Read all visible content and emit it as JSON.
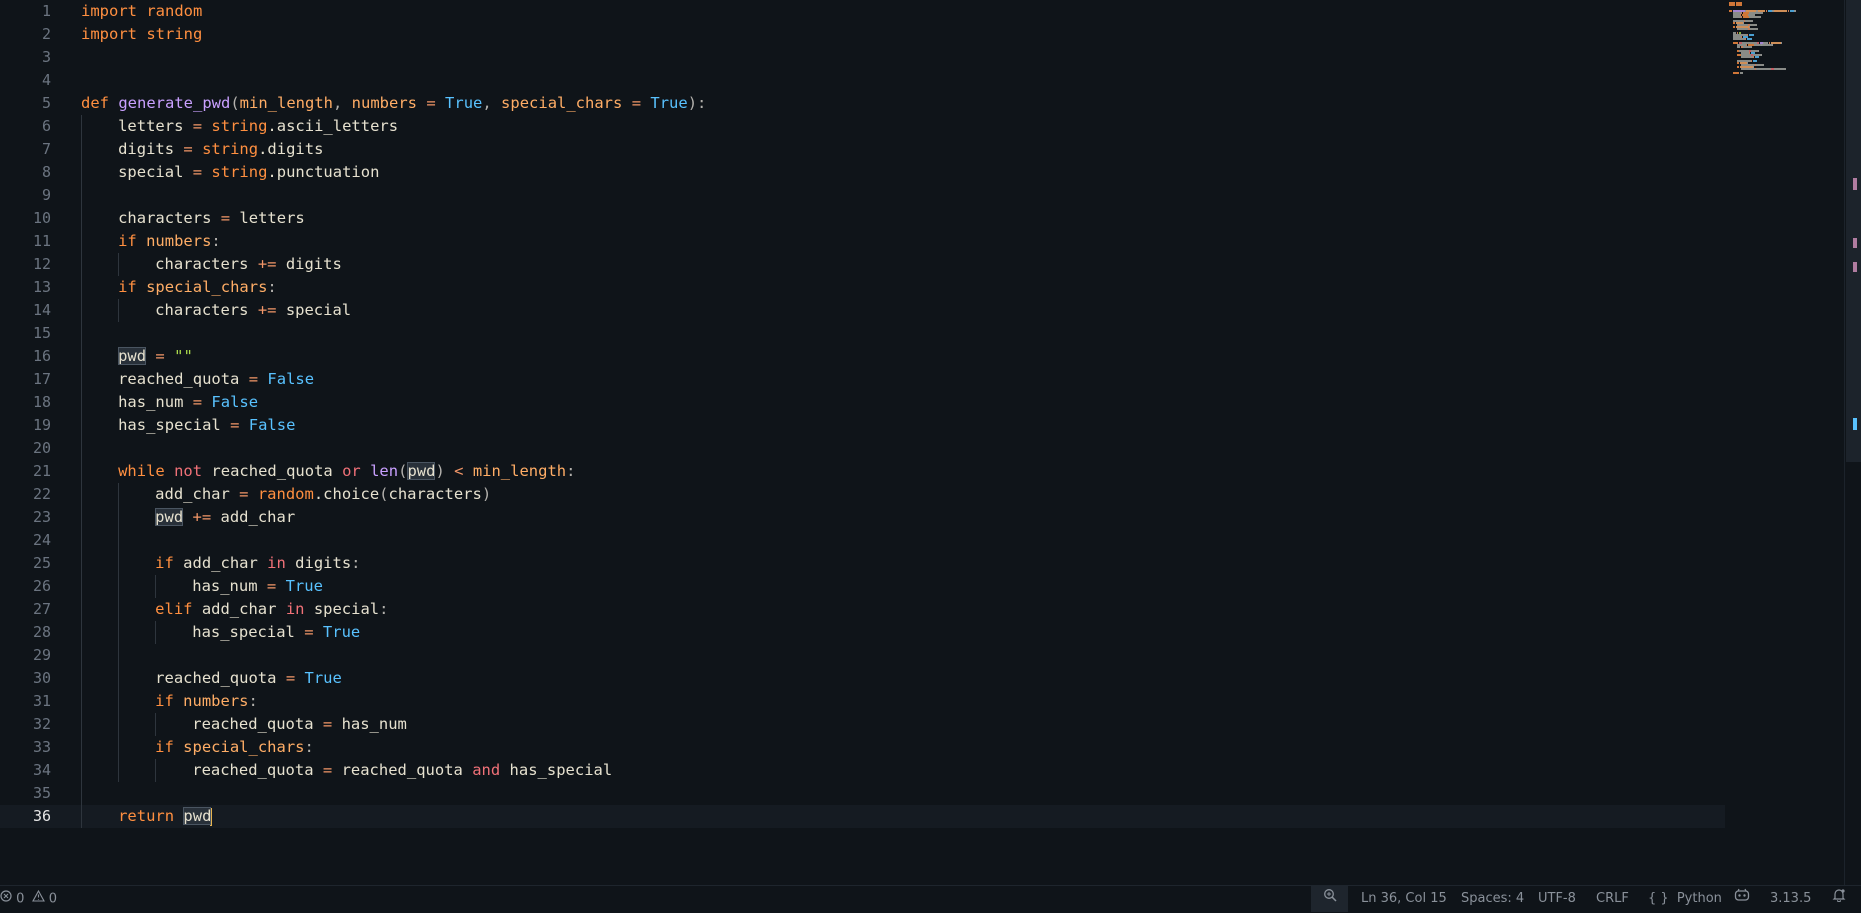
{
  "editor": {
    "current_line": 36,
    "lines": [
      {
        "n": "1",
        "indent": 0,
        "tokens": [
          [
            "t-kw",
            "import"
          ],
          [
            "t-var",
            " "
          ],
          [
            "t-mod",
            "random"
          ]
        ]
      },
      {
        "n": "2",
        "indent": 0,
        "tokens": [
          [
            "t-kw",
            "import"
          ],
          [
            "t-var",
            " "
          ],
          [
            "t-mod",
            "string"
          ]
        ]
      },
      {
        "n": "3",
        "indent": 0,
        "tokens": []
      },
      {
        "n": "4",
        "indent": 0,
        "tokens": []
      },
      {
        "n": "5",
        "indent": 0,
        "tokens": [
          [
            "t-kw",
            "def"
          ],
          [
            "t-var",
            " "
          ],
          [
            "t-fn",
            "generate_pwd"
          ],
          [
            "t-punc",
            "("
          ],
          [
            "t-param",
            "min_length"
          ],
          [
            "t-punc",
            ", "
          ],
          [
            "t-param",
            "numbers"
          ],
          [
            "t-var",
            " "
          ],
          [
            "t-op",
            "="
          ],
          [
            "t-var",
            " "
          ],
          [
            "t-const",
            "True"
          ],
          [
            "t-punc",
            ", "
          ],
          [
            "t-param",
            "special_chars"
          ],
          [
            "t-var",
            " "
          ],
          [
            "t-op",
            "="
          ],
          [
            "t-var",
            " "
          ],
          [
            "t-const",
            "True"
          ],
          [
            "t-punc",
            "):"
          ]
        ]
      },
      {
        "n": "6",
        "indent": 1,
        "tokens": [
          [
            "t-var",
            "letters "
          ],
          [
            "t-op",
            "="
          ],
          [
            "t-var",
            " "
          ],
          [
            "t-mod",
            "string"
          ],
          [
            "t-var",
            ".ascii_letters"
          ]
        ]
      },
      {
        "n": "7",
        "indent": 1,
        "tokens": [
          [
            "t-var",
            "digits "
          ],
          [
            "t-op",
            "="
          ],
          [
            "t-var",
            " "
          ],
          [
            "t-mod",
            "string"
          ],
          [
            "t-var",
            ".digits"
          ]
        ]
      },
      {
        "n": "8",
        "indent": 1,
        "tokens": [
          [
            "t-var",
            "special "
          ],
          [
            "t-op",
            "="
          ],
          [
            "t-var",
            " "
          ],
          [
            "t-mod",
            "string"
          ],
          [
            "t-var",
            ".punctuation"
          ]
        ]
      },
      {
        "n": "9",
        "indent": 1,
        "tokens": []
      },
      {
        "n": "10",
        "indent": 1,
        "tokens": [
          [
            "t-var",
            "characters "
          ],
          [
            "t-op",
            "="
          ],
          [
            "t-var",
            " letters"
          ]
        ]
      },
      {
        "n": "11",
        "indent": 1,
        "tokens": [
          [
            "t-kw",
            "if"
          ],
          [
            "t-var",
            " "
          ],
          [
            "t-param",
            "numbers"
          ],
          [
            "t-punc",
            ":"
          ]
        ]
      },
      {
        "n": "12",
        "indent": 2,
        "tokens": [
          [
            "t-var",
            "characters "
          ],
          [
            "t-op",
            "+="
          ],
          [
            "t-var",
            " digits"
          ]
        ]
      },
      {
        "n": "13",
        "indent": 1,
        "tokens": [
          [
            "t-kw",
            "if"
          ],
          [
            "t-var",
            " "
          ],
          [
            "t-param",
            "special_chars"
          ],
          [
            "t-punc",
            ":"
          ]
        ]
      },
      {
        "n": "14",
        "indent": 2,
        "tokens": [
          [
            "t-var",
            "characters "
          ],
          [
            "t-op",
            "+="
          ],
          [
            "t-var",
            " special"
          ]
        ]
      },
      {
        "n": "15",
        "indent": 1,
        "tokens": []
      },
      {
        "n": "16",
        "indent": 1,
        "tokens": [
          [
            "t-var hl",
            "pwd"
          ],
          [
            "t-var",
            " "
          ],
          [
            "t-op",
            "="
          ],
          [
            "t-var",
            " "
          ],
          [
            "t-str",
            "\"\""
          ]
        ]
      },
      {
        "n": "17",
        "indent": 1,
        "tokens": [
          [
            "t-var",
            "reached_quota "
          ],
          [
            "t-op",
            "="
          ],
          [
            "t-var",
            " "
          ],
          [
            "t-const",
            "False"
          ]
        ]
      },
      {
        "n": "18",
        "indent": 1,
        "tokens": [
          [
            "t-var",
            "has_num "
          ],
          [
            "t-op",
            "="
          ],
          [
            "t-var",
            " "
          ],
          [
            "t-const",
            "False"
          ]
        ]
      },
      {
        "n": "19",
        "indent": 1,
        "tokens": [
          [
            "t-var",
            "has_special "
          ],
          [
            "t-op",
            "="
          ],
          [
            "t-var",
            " "
          ],
          [
            "t-const",
            "False"
          ]
        ]
      },
      {
        "n": "20",
        "indent": 1,
        "tokens": []
      },
      {
        "n": "21",
        "indent": 1,
        "tokens": [
          [
            "t-kw",
            "while"
          ],
          [
            "t-var",
            " "
          ],
          [
            "t-kw2",
            "not"
          ],
          [
            "t-var",
            " reached_quota "
          ],
          [
            "t-kw2",
            "or"
          ],
          [
            "t-var",
            " "
          ],
          [
            "t-fn",
            "len"
          ],
          [
            "t-punc",
            "("
          ],
          [
            "t-var hl",
            "pwd"
          ],
          [
            "t-punc",
            ")"
          ],
          [
            "t-var",
            " "
          ],
          [
            "t-op",
            "<"
          ],
          [
            "t-var",
            " "
          ],
          [
            "t-param",
            "min_length"
          ],
          [
            "t-punc",
            ":"
          ]
        ]
      },
      {
        "n": "22",
        "indent": 2,
        "tokens": [
          [
            "t-var",
            "add_char "
          ],
          [
            "t-op",
            "="
          ],
          [
            "t-var",
            " "
          ],
          [
            "t-mod",
            "random"
          ],
          [
            "t-var",
            ".choice"
          ],
          [
            "t-punc",
            "("
          ],
          [
            "t-var",
            "characters"
          ],
          [
            "t-punc",
            ")"
          ]
        ]
      },
      {
        "n": "23",
        "indent": 2,
        "tokens": [
          [
            "t-var hl",
            "pwd"
          ],
          [
            "t-var",
            " "
          ],
          [
            "t-op",
            "+="
          ],
          [
            "t-var",
            " add_char"
          ]
        ]
      },
      {
        "n": "24",
        "indent": 2,
        "tokens": []
      },
      {
        "n": "25",
        "indent": 2,
        "tokens": [
          [
            "t-kw",
            "if"
          ],
          [
            "t-var",
            " add_char "
          ],
          [
            "t-kw2",
            "in"
          ],
          [
            "t-var",
            " digits"
          ],
          [
            "t-punc",
            ":"
          ]
        ]
      },
      {
        "n": "26",
        "indent": 3,
        "tokens": [
          [
            "t-var",
            "has_num "
          ],
          [
            "t-op",
            "="
          ],
          [
            "t-var",
            " "
          ],
          [
            "t-const",
            "True"
          ]
        ]
      },
      {
        "n": "27",
        "indent": 2,
        "tokens": [
          [
            "t-kw",
            "elif"
          ],
          [
            "t-var",
            " add_char "
          ],
          [
            "t-kw2",
            "in"
          ],
          [
            "t-var",
            " special"
          ],
          [
            "t-punc",
            ":"
          ]
        ]
      },
      {
        "n": "28",
        "indent": 3,
        "tokens": [
          [
            "t-var",
            "has_special "
          ],
          [
            "t-op",
            "="
          ],
          [
            "t-var",
            " "
          ],
          [
            "t-const",
            "True"
          ]
        ]
      },
      {
        "n": "29",
        "indent": 2,
        "tokens": []
      },
      {
        "n": "30",
        "indent": 2,
        "tokens": [
          [
            "t-var",
            "reached_quota "
          ],
          [
            "t-op",
            "="
          ],
          [
            "t-var",
            " "
          ],
          [
            "t-const",
            "True"
          ]
        ]
      },
      {
        "n": "31",
        "indent": 2,
        "tokens": [
          [
            "t-kw",
            "if"
          ],
          [
            "t-var",
            " "
          ],
          [
            "t-param",
            "numbers"
          ],
          [
            "t-punc",
            ":"
          ]
        ]
      },
      {
        "n": "32",
        "indent": 3,
        "tokens": [
          [
            "t-var",
            "reached_quota "
          ],
          [
            "t-op",
            "="
          ],
          [
            "t-var",
            " has_num"
          ]
        ]
      },
      {
        "n": "33",
        "indent": 2,
        "tokens": [
          [
            "t-kw",
            "if"
          ],
          [
            "t-var",
            " "
          ],
          [
            "t-param",
            "special_chars"
          ],
          [
            "t-punc",
            ":"
          ]
        ]
      },
      {
        "n": "34",
        "indent": 3,
        "tokens": [
          [
            "t-var",
            "reached_quota "
          ],
          [
            "t-op",
            "="
          ],
          [
            "t-var",
            " reached_quota "
          ],
          [
            "t-kw2",
            "and"
          ],
          [
            "t-var",
            " has_special"
          ]
        ]
      },
      {
        "n": "35",
        "indent": 1,
        "tokens": []
      },
      {
        "n": "36",
        "indent": 1,
        "tokens": [
          [
            "t-kw",
            "return"
          ],
          [
            "t-var",
            " "
          ],
          [
            "t-var hl",
            "pwd"
          ],
          [
            "cursor",
            ""
          ]
        ]
      }
    ]
  },
  "statusbar": {
    "errors_count": "0",
    "warnings_count": "0",
    "cursor_position": "Ln 36, Col 15",
    "indentation": "Spaces: 4",
    "encoding": "UTF-8",
    "line_ending": "CRLF",
    "language_icon": "{ }",
    "language": "Python",
    "python_version": "3.13.5"
  },
  "icons": {
    "errors": "error-circle-icon",
    "warnings": "warning-triangle-icon",
    "zoom": "zoom-icon",
    "copilot": "copilot-icon",
    "notifications": "bell-icon"
  }
}
